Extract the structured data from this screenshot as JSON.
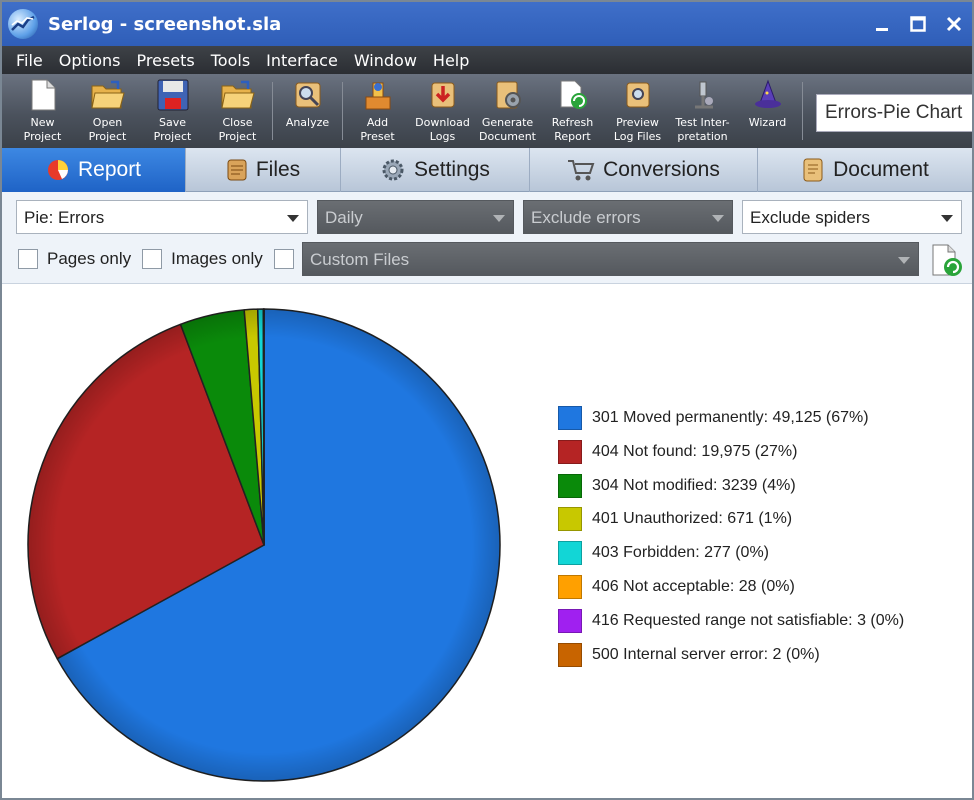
{
  "window": {
    "title": "Serlog - screenshot.sla"
  },
  "window_controls": {
    "minimize": "‒",
    "maximize": "☐",
    "close": "✕"
  },
  "menu": [
    "File",
    "Options",
    "Presets",
    "Tools",
    "Interface",
    "Window",
    "Help"
  ],
  "toolbar": {
    "buttons": [
      {
        "label1": "New",
        "label2": "Project",
        "icon": "new-file-icon"
      },
      {
        "label1": "Open",
        "label2": "Project",
        "icon": "open-folder-icon"
      },
      {
        "label1": "Save",
        "label2": "Project",
        "icon": "floppy-disk-icon"
      },
      {
        "label1": "Close",
        "label2": "Project",
        "icon": "close-folder-icon"
      },
      {
        "label1": "Analyze",
        "label2": "",
        "icon": "magnifier-scroll-icon"
      },
      {
        "label1": "Add",
        "label2": "Preset",
        "icon": "add-preset-icon"
      },
      {
        "label1": "Download",
        "label2": "Logs",
        "icon": "download-icon"
      },
      {
        "label1": "Generate",
        "label2": "Document",
        "icon": "gear-document-icon"
      },
      {
        "label1": "Refresh",
        "label2": "Report",
        "icon": "refresh-document-icon"
      },
      {
        "label1": "Preview",
        "label2": "Log Files",
        "icon": "preview-scroll-icon"
      },
      {
        "label1": "Test Inter-",
        "label2": "pretation",
        "icon": "microscope-icon"
      },
      {
        "label1": "Wizard",
        "label2": "",
        "icon": "wizard-hat-icon"
      }
    ],
    "preset_value": "Errors-Pie Chart"
  },
  "tabs": [
    {
      "label": "Report",
      "icon": "pie-chart-icon",
      "active": true
    },
    {
      "label": "Files",
      "icon": "scroll-icon",
      "active": false
    },
    {
      "label": "Settings",
      "icon": "gear-icon",
      "active": false
    },
    {
      "label": "Conversions",
      "icon": "cart-icon",
      "active": false
    },
    {
      "label": "Document",
      "icon": "document-scroll-icon",
      "active": false
    }
  ],
  "filters": {
    "report_type": "Pie: Errors",
    "period": "Daily",
    "errors_filter": "Exclude errors",
    "spiders_filter": "Exclude spiders",
    "pages_only": "Pages only",
    "images_only": "Images only",
    "custom_files": "Custom Files"
  },
  "chart_data": {
    "type": "pie",
    "slices": [
      {
        "label": "301 Moved permanently: 49,125 (67%)",
        "value": 49125,
        "color": "#1f77e0"
      },
      {
        "label": "404 Not found: 19,975 (27%)",
        "value": 19975,
        "color": "#b52424"
      },
      {
        "label": "304 Not modified: 3239 (4%)",
        "value": 3239,
        "color": "#0a8a0a"
      },
      {
        "label": "401 Unauthorized: 671 (1%)",
        "value": 671,
        "color": "#c8c800"
      },
      {
        "label": "403 Forbidden: 277 (0%)",
        "value": 277,
        "color": "#12d6d6"
      },
      {
        "label": "406 Not acceptable: 28 (0%)",
        "value": 28,
        "color": "#ffa000"
      },
      {
        "label": "416 Requested range not satisfiable: 3 (0%)",
        "value": 3,
        "color": "#a020f0"
      },
      {
        "label": "500 Internal server error: 2 (0%)",
        "value": 2,
        "color": "#c86400"
      }
    ],
    "legend_position": "right"
  }
}
